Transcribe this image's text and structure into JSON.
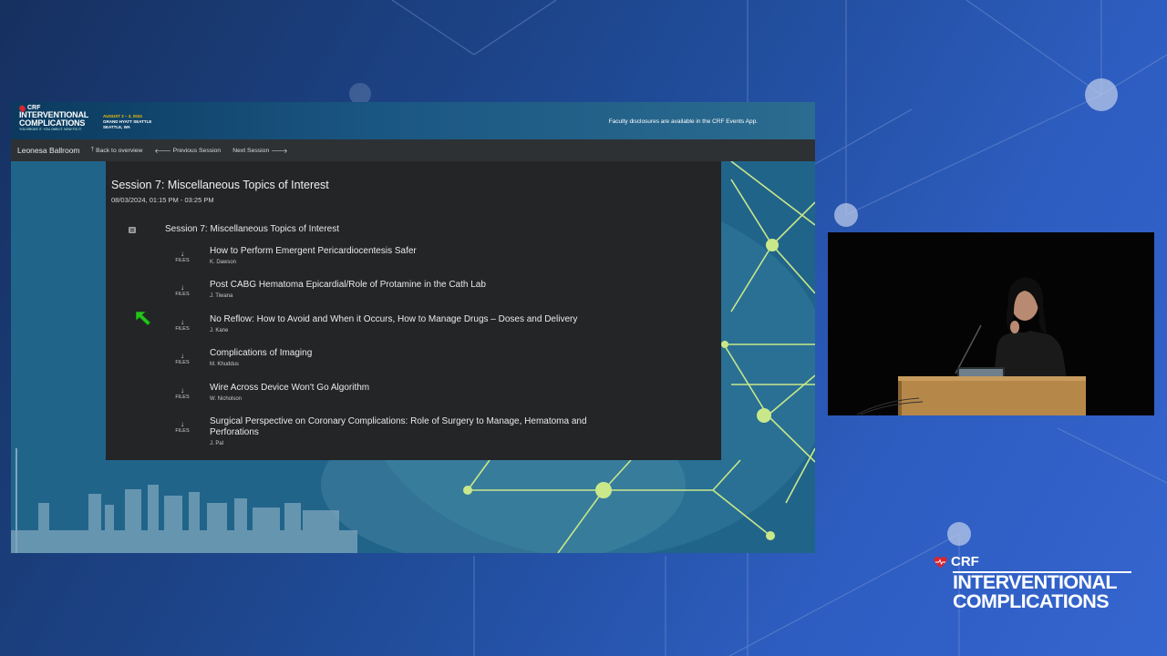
{
  "banner": {
    "crf": "CRF",
    "title_line1": "INTERVENTIONAL",
    "title_line2": "COMPLICATIONS",
    "tagline": "YOU BROKE IT. YOU OWN IT. NOW FIX IT.",
    "dates": "AUGUST 2 – 3, 2024",
    "venue": "GRAND HYATT SEATTLE",
    "city": "SEATTLE, WA",
    "disclosure": "Faculty disclosures are available in the CRF Events App."
  },
  "navbar": {
    "room": "Leonesa Ballroom",
    "back": "Back to overview",
    "previous": "Previous Session",
    "next": "Next Session",
    "icons": {
      "back": "arrow-up-icon",
      "previous": "arrow-left-icon",
      "next": "arrow-right-icon"
    }
  },
  "session": {
    "title": "Session 7: Miscellaneous Topics of Interest",
    "time": "08/03/2024, 01:15 PM - 03:25 PM",
    "group_title": "Session 7: Miscellaneous Topics of Interest",
    "files_label": "FILES",
    "talks": [
      {
        "title": "How to Perform Emergent Pericardiocentesis Safer",
        "speaker": "K. Dawson"
      },
      {
        "title": "Post CABG Hematoma Epicardial/Role of Protamine in the Cath Lab",
        "speaker": "J. Tiwana"
      },
      {
        "title": "No Reflow: How to Avoid and When it Occurs, How to Manage Drugs – Doses and Delivery",
        "speaker": "J. Kane"
      },
      {
        "title": "Complications of Imaging",
        "speaker": "M. Khuddus"
      },
      {
        "title": "Wire Across Device Won't Go Algorithm",
        "speaker": "W. Nicholson"
      },
      {
        "title": "Surgical Perspective on Coronary Complications: Role of Surgery to Manage, Hematoma and Perforations",
        "speaker": "J. Pal"
      }
    ]
  },
  "brand": {
    "crf": "CRF",
    "line1": "INTERVENTIONAL",
    "line2": "COMPLICATIONS"
  },
  "colors": {
    "accent_yellow": "#f4c000",
    "brand_red": "#d8262f",
    "cursor_green": "#27c31f",
    "panel": "#232527",
    "navbar": "#2e3134"
  }
}
